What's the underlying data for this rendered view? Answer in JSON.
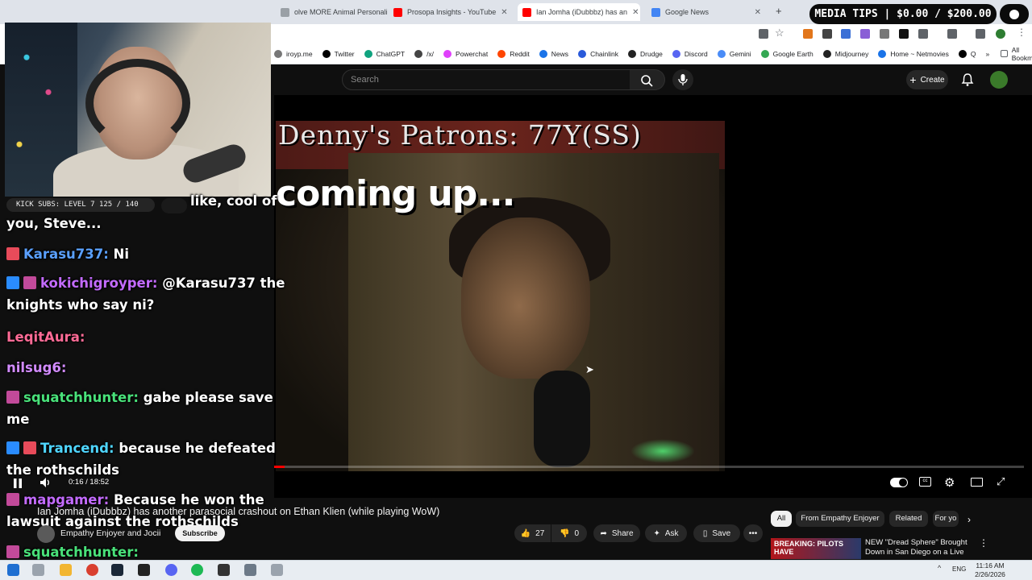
{
  "browser": {
    "tabs": [
      {
        "title": "olve MORE Animal Personali",
        "color": "#9aa0a6",
        "active": false
      },
      {
        "title": "Prosopa Insights - YouTube",
        "color": "#ff0000",
        "active": false
      },
      {
        "title": "Ian Jomha (iDubbbz) has an",
        "color": "#ff0000",
        "active": true
      },
      {
        "title": "Google News",
        "color": "#4285f4",
        "active": false
      }
    ],
    "new_tab": "+",
    "bookmarks": [
      {
        "label": "iroyp.me",
        "color": "#777"
      },
      {
        "label": "Twitter",
        "color": "#000"
      },
      {
        "label": "ChatGPT",
        "color": "#10a37f"
      },
      {
        "label": "/x/",
        "color": "#444"
      },
      {
        "label": "Powerchat",
        "color": "#e040fb"
      },
      {
        "label": "Reddit",
        "color": "#ff4500"
      },
      {
        "label": "News",
        "color": "#1a73e8"
      },
      {
        "label": "Chainlink",
        "color": "#2a5ada"
      },
      {
        "label": "Drudge",
        "color": "#222"
      },
      {
        "label": "Discord",
        "color": "#5865f2"
      },
      {
        "label": "Gemini",
        "color": "#4a8cf7"
      },
      {
        "label": "Google Earth",
        "color": "#34a853"
      },
      {
        "label": "Midjourney",
        "color": "#222"
      },
      {
        "label": "Home ~ Netmovies",
        "color": "#1a73e8"
      },
      {
        "label": "Q",
        "color": "#000"
      }
    ],
    "all_bookmarks": "All Bookmarks",
    "more_bookmarks": "»"
  },
  "youtube": {
    "search_placeholder": "Search",
    "create_label": "Create",
    "video_time": "0:16 / 18:52",
    "progress_fraction": 0.014,
    "video_title": "Ian Jomha (iDubbbz) has another parasocial crashout on Ethan Klien (while playing WoW)",
    "channel_name": "Empathy Enjoyer and Jocii",
    "subscribe_label": "Subscribe",
    "likes": "27",
    "dislikes": "0",
    "share_label": "Share",
    "ask_label": "Ask",
    "save_label": "Save",
    "chips": [
      "All",
      "From Empathy Enjoyer",
      "Related",
      "For yo"
    ],
    "rec_thumb_text": "BREAKING: PILOTS HAVE",
    "rec_title": "NEW \"Dread Sphere\" Brought Down in San Diego on a Live ..."
  },
  "video_frame": {
    "headline": "Denny's Patrons: 77Y(SS)",
    "subline": "coming up..."
  },
  "stream_overlay": {
    "subs_banner": "KICK SUBS: LEVEL 7 125 / 140",
    "chat_partial_top": "like, cool of",
    "chat_partial_top2": "you, Steve...",
    "chat": [
      {
        "user": "Karasu737:",
        "msg": " Ni",
        "userClass": "u-blue",
        "badges": [
          "#e84b5a"
        ]
      },
      {
        "user": "kokichigroyper:",
        "msg": " @Karasu737 the knights who say ni?",
        "userClass": "u-purple",
        "badges": [
          "#2a8cff",
          "#c24a9a"
        ]
      },
      {
        "user": "LeqitAura:",
        "msg": " ",
        "userClass": "u-pink",
        "badges": []
      },
      {
        "user": "nilsug6:",
        "msg": " ",
        "userClass": "u-purple2",
        "badges": []
      },
      {
        "user": "squatchhunter:",
        "msg": " gabe please save me",
        "userClass": "u-green",
        "badges": [
          "#c24a9a"
        ]
      },
      {
        "user": "Trancend:",
        "msg": " because he defeated the rothschilds",
        "userClass": "u-cyan",
        "badges": [
          "#2a8cff",
          "#e84b5a"
        ]
      },
      {
        "user": "mapgamer:",
        "msg": " Because he won the lawsuit against the rothschilds",
        "userClass": "u-purple",
        "badges": [
          "#c24a9a"
        ]
      },
      {
        "user": "squatchhunter:",
        "msg": "",
        "userClass": "u-green2",
        "badges": [
          "#c24a9a"
        ]
      }
    ],
    "media_tips": "MEDIA TIPS | $0.00 / $200.00"
  },
  "taskbar": {
    "lang": "ENG",
    "time": "11:16 AM",
    "date": "2/26/2026"
  }
}
